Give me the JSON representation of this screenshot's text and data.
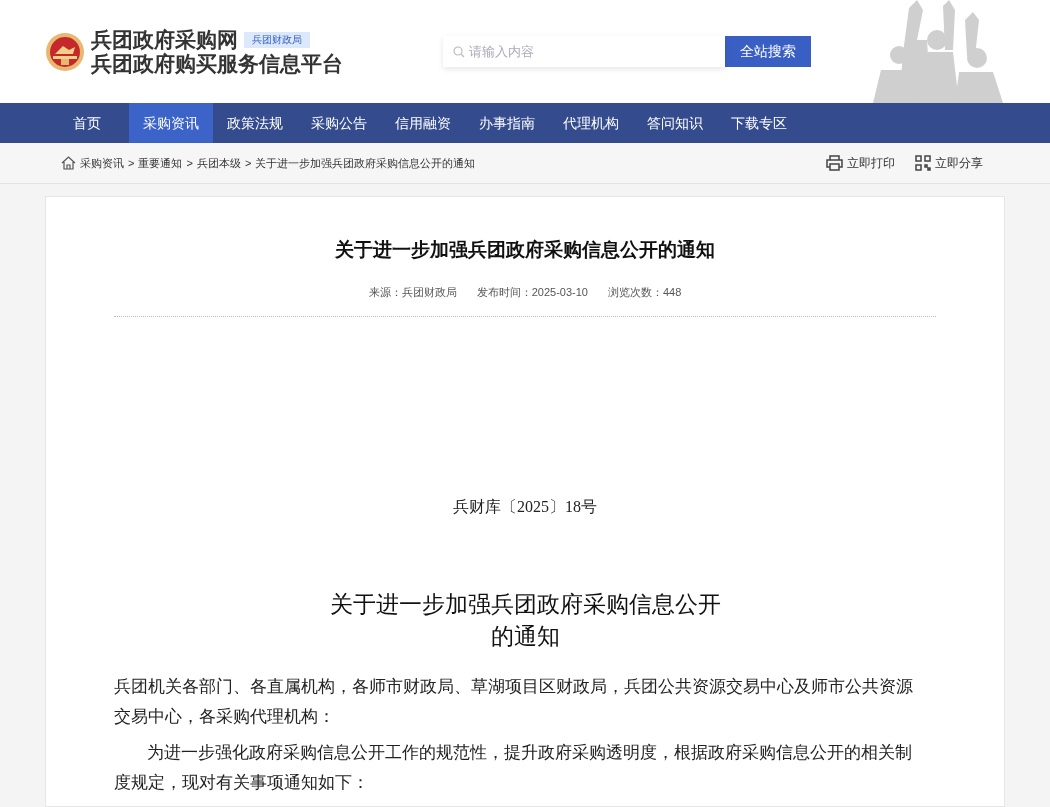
{
  "header": {
    "site_name": "兵团政府采购网",
    "badge": "兵团财政局",
    "subtitle": "兵团政府购买服务信息平台",
    "search": {
      "placeholder": "请输入内容",
      "button": "全站搜索"
    }
  },
  "nav": [
    {
      "label": "首页",
      "selected": false
    },
    {
      "label": "采购资讯",
      "selected": true
    },
    {
      "label": "政策法规",
      "selected": false
    },
    {
      "label": "采购公告",
      "selected": false
    },
    {
      "label": "信用融资",
      "selected": false
    },
    {
      "label": "办事指南",
      "selected": false
    },
    {
      "label": "代理机构",
      "selected": false
    },
    {
      "label": "答问知识",
      "selected": false
    },
    {
      "label": "下载专区",
      "selected": false
    }
  ],
  "breadcrumb": [
    {
      "label": "采购资讯"
    },
    {
      "label": "重要通知"
    },
    {
      "label": "兵团本级"
    },
    {
      "label": "关于进一步加强兵团政府采购信息公开的通知"
    }
  ],
  "breadcrumb_separator": ">",
  "actions": [
    {
      "kind": "print",
      "label": "立即打印"
    },
    {
      "kind": "share",
      "label": "立即分享"
    }
  ],
  "article": {
    "title": "关于进一步加强兵团政府采购信息公开的通知",
    "meta": [
      "来源：兵团财政局",
      "发布时间：2025-03-10",
      "浏览次数：448"
    ],
    "doc_number": "兵财库〔2025〕18号",
    "doc_title": "关于进一步加强兵团政府采购信息公开的通知",
    "paragraphs": [
      {
        "indent": false,
        "text": "兵团机关各部门、各直属机构，各师市财政局、草湖项目区财政局，兵团公共资源交易中心及师市公共资源交易中心，各采购代理机构："
      },
      {
        "indent": true,
        "text": "为进一步强化政府采购信息公开工作的规范性，提升政府采购透明度，根据政府采购信息公开的相关制度规定，现对有关事项通知如下："
      }
    ]
  }
}
